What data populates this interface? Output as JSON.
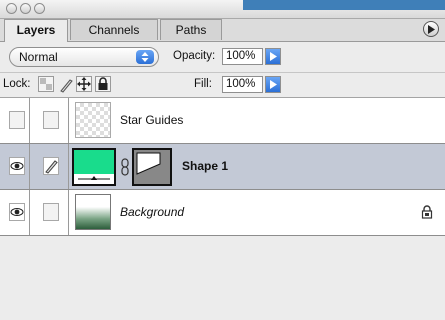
{
  "tabs": [
    {
      "label": "Layers",
      "active": true
    },
    {
      "label": "Channels",
      "active": false
    },
    {
      "label": "Paths",
      "active": false
    }
  ],
  "blend_mode": {
    "value": "Normal"
  },
  "opacity": {
    "label": "Opacity:",
    "value": "100%"
  },
  "lock": {
    "label": "Lock:"
  },
  "fill": {
    "label": "Fill:",
    "value": "100%"
  },
  "layers": [
    {
      "name": "Star Guides",
      "visible": false,
      "italic": false,
      "bold": false,
      "selected": false
    },
    {
      "name": "Shape 1",
      "visible": true,
      "italic": false,
      "bold": true,
      "selected": true,
      "swatch_color": "#19dc8c"
    },
    {
      "name": "Background",
      "visible": true,
      "italic": true,
      "bold": false,
      "selected": false,
      "locked": true
    }
  ],
  "colors": {
    "selection": "#c3c9d6",
    "shape_fill": "#19dc8c",
    "accent_blue": "#2b6fd6"
  }
}
